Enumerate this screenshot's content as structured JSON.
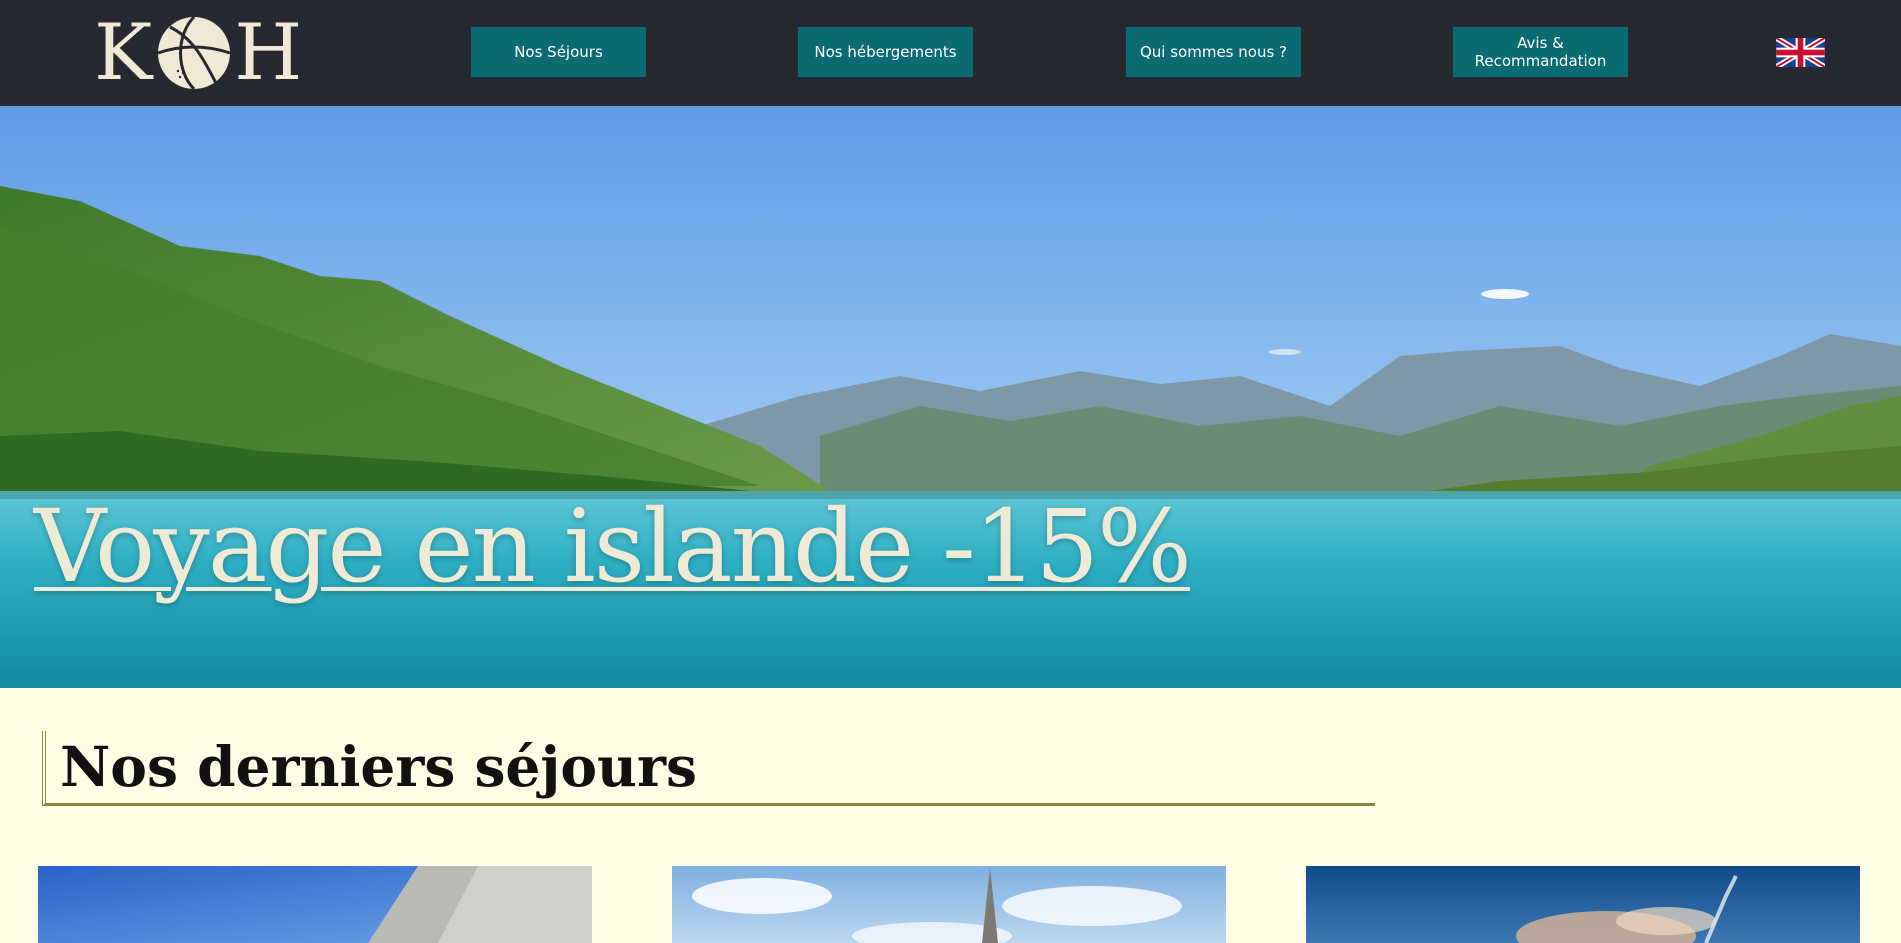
{
  "logo": {
    "left_letter": "K",
    "right_letter": "H",
    "icon": "basketball-icon"
  },
  "nav": [
    {
      "label": "Nos Séjours"
    },
    {
      "label": "Nos hébergements"
    },
    {
      "label": "Qui sommes nous ?"
    },
    {
      "label": "Avis & Recommandation"
    }
  ],
  "language": {
    "icon": "uk-flag-icon"
  },
  "hero": {
    "title": "Voyage en islande -15%"
  },
  "section": {
    "title": "Nos derniers séjours"
  },
  "cards": [
    {
      "icon": "stone-pyramid-image"
    },
    {
      "icon": "church-spire-image"
    },
    {
      "icon": "sunset-sky-image"
    }
  ],
  "colors": {
    "header_bg": "#262a30",
    "button_bg": "#0a6b72",
    "page_bg": "#fefee6",
    "accent_line": "#8a8a3c",
    "hero_text": "#efead6"
  }
}
